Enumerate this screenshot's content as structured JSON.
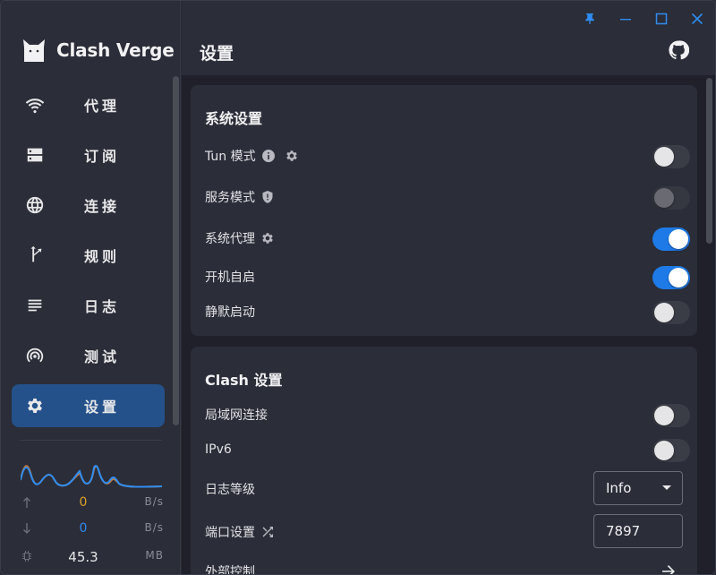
{
  "app": {
    "name": "Clash Verge"
  },
  "colors": {
    "accent": "#1e7ae6",
    "active_nav": "#24518a",
    "upload_value": "#e0a02a",
    "download_value": "#2f8cf0",
    "window_buttons": "#2f8cf0"
  },
  "sidebar": {
    "items": [
      {
        "label": "代理",
        "icon": "wifi-icon"
      },
      {
        "label": "订阅",
        "icon": "server-icon"
      },
      {
        "label": "连接",
        "icon": "globe-icon"
      },
      {
        "label": "规则",
        "icon": "fork-icon"
      },
      {
        "label": "日志",
        "icon": "lines-icon"
      },
      {
        "label": "测试",
        "icon": "radar-icon"
      },
      {
        "label": "设置",
        "icon": "gear-icon",
        "active": true
      }
    ],
    "traffic": {
      "upload": {
        "value": "0",
        "unit": "B/s"
      },
      "download": {
        "value": "0",
        "unit": "B/s"
      },
      "memory": {
        "value": "45.3",
        "unit": "MB"
      }
    }
  },
  "header": {
    "title": "设置"
  },
  "system_settings": {
    "title": "系统设置",
    "rows": [
      {
        "label": "Tun 模式",
        "state": "off"
      },
      {
        "label": "服务模式",
        "state": "disabled"
      },
      {
        "label": "系统代理",
        "state": "on"
      },
      {
        "label": "开机自启",
        "state": "on"
      },
      {
        "label": "静默启动",
        "state": "off"
      }
    ]
  },
  "clash_settings": {
    "title": "Clash 设置",
    "lan": {
      "label": "局域网连接",
      "state": "off"
    },
    "ipv6": {
      "label": "IPv6",
      "state": "off"
    },
    "log_level": {
      "label": "日志等级",
      "value": "Info"
    },
    "port": {
      "label": "端口设置",
      "value": "7897"
    },
    "external": {
      "label": "外部控制"
    }
  }
}
